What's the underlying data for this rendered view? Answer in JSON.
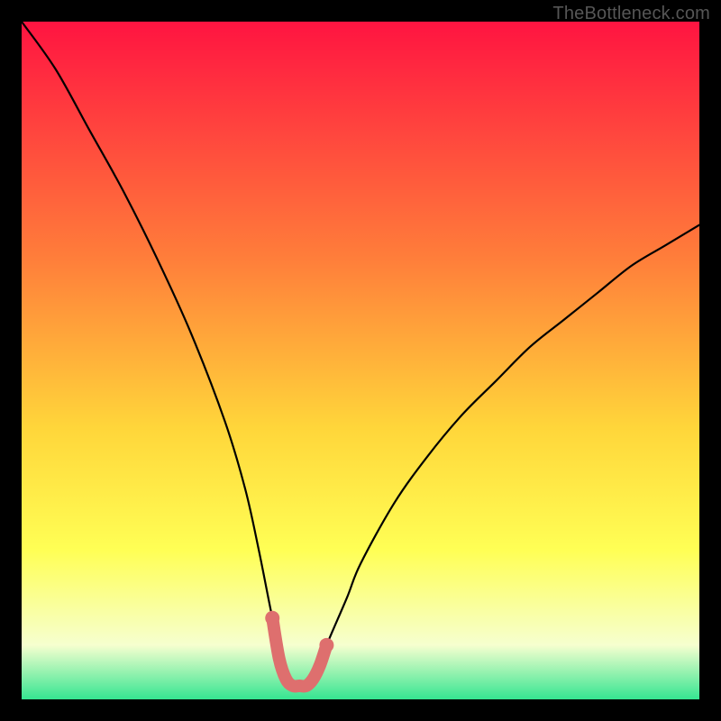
{
  "watermark": "TheBottleneck.com",
  "colors": {
    "frame": "#000000",
    "curve": "#000000",
    "markers": "#de6f6e",
    "gradient_top": "#ff1441",
    "gradient_mid1": "#ff7e3a",
    "gradient_mid2": "#ffd63a",
    "gradient_mid3": "#ffff55",
    "gradient_mid4": "#f6ffcf",
    "gradient_bottom": "#35e591"
  },
  "chart_data": {
    "type": "line",
    "title": "",
    "xlabel": "",
    "ylabel": "",
    "xlim": [
      0,
      100
    ],
    "ylim": [
      0,
      100
    ],
    "grid": false,
    "legend": false,
    "series": [
      {
        "name": "bottleneck-curve",
        "x": [
          0,
          5,
          10,
          15,
          20,
          25,
          30,
          33,
          35,
          37,
          39,
          40,
          41,
          42,
          43,
          44,
          45,
          48,
          50,
          55,
          60,
          65,
          70,
          75,
          80,
          85,
          90,
          95,
          100
        ],
        "values": [
          100,
          93,
          84,
          75,
          65,
          54,
          41,
          31,
          22,
          12,
          3,
          2,
          2,
          2,
          3,
          5,
          8,
          15,
          20,
          29,
          36,
          42,
          47,
          52,
          56,
          60,
          64,
          67,
          70
        ]
      }
    ],
    "marker_points": {
      "name": "minimum-markers",
      "x": [
        37,
        38,
        39,
        40,
        41,
        42,
        43,
        44,
        45
      ],
      "values": [
        12,
        6,
        3,
        2,
        2,
        2,
        3,
        5,
        8
      ]
    }
  }
}
